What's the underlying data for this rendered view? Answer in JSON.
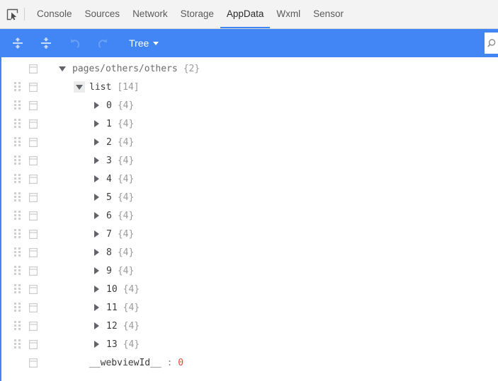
{
  "tabbar": {
    "inspect_icon": "inspect-element-icon",
    "tabs": [
      {
        "label": "Console",
        "active": false
      },
      {
        "label": "Sources",
        "active": false
      },
      {
        "label": "Network",
        "active": false
      },
      {
        "label": "Storage",
        "active": false
      },
      {
        "label": "AppData",
        "active": true
      },
      {
        "label": "Wxml",
        "active": false
      },
      {
        "label": "Sensor",
        "active": false
      }
    ]
  },
  "toolbar": {
    "expand_all_icon": "expand-all-icon",
    "collapse_all_icon": "collapse-all-icon",
    "undo_icon": "undo-icon",
    "redo_icon": "redo-icon",
    "view_mode_label": "Tree",
    "search_icon": "search-icon",
    "search_value": "",
    "search_placeholder": "",
    "accent_color": "#4285f4"
  },
  "tree": {
    "rows": [
      {
        "handle": false,
        "indent": 0,
        "toggle": "down",
        "toggle_highlight": false,
        "key": "pages/others/others",
        "key_style": "root",
        "meta": "{2}",
        "value": null
      },
      {
        "handle": true,
        "indent": 1,
        "toggle": "down",
        "toggle_highlight": true,
        "key": "list",
        "key_style": "key",
        "meta": "[14]",
        "value": null
      },
      {
        "handle": true,
        "indent": 2,
        "toggle": "right",
        "toggle_highlight": false,
        "key": "0",
        "key_style": "index",
        "meta": "{4}",
        "value": null
      },
      {
        "handle": true,
        "indent": 2,
        "toggle": "right",
        "toggle_highlight": false,
        "key": "1",
        "key_style": "index",
        "meta": "{4}",
        "value": null
      },
      {
        "handle": true,
        "indent": 2,
        "toggle": "right",
        "toggle_highlight": false,
        "key": "2",
        "key_style": "index",
        "meta": "{4}",
        "value": null
      },
      {
        "handle": true,
        "indent": 2,
        "toggle": "right",
        "toggle_highlight": false,
        "key": "3",
        "key_style": "index",
        "meta": "{4}",
        "value": null
      },
      {
        "handle": true,
        "indent": 2,
        "toggle": "right",
        "toggle_highlight": false,
        "key": "4",
        "key_style": "index",
        "meta": "{4}",
        "value": null
      },
      {
        "handle": true,
        "indent": 2,
        "toggle": "right",
        "toggle_highlight": false,
        "key": "5",
        "key_style": "index",
        "meta": "{4}",
        "value": null
      },
      {
        "handle": true,
        "indent": 2,
        "toggle": "right",
        "toggle_highlight": false,
        "key": "6",
        "key_style": "index",
        "meta": "{4}",
        "value": null
      },
      {
        "handle": true,
        "indent": 2,
        "toggle": "right",
        "toggle_highlight": false,
        "key": "7",
        "key_style": "index",
        "meta": "{4}",
        "value": null
      },
      {
        "handle": true,
        "indent": 2,
        "toggle": "right",
        "toggle_highlight": false,
        "key": "8",
        "key_style": "index",
        "meta": "{4}",
        "value": null
      },
      {
        "handle": true,
        "indent": 2,
        "toggle": "right",
        "toggle_highlight": false,
        "key": "9",
        "key_style": "index",
        "meta": "{4}",
        "value": null
      },
      {
        "handle": true,
        "indent": 2,
        "toggle": "right",
        "toggle_highlight": false,
        "key": "10",
        "key_style": "index",
        "meta": "{4}",
        "value": null
      },
      {
        "handle": true,
        "indent": 2,
        "toggle": "right",
        "toggle_highlight": false,
        "key": "11",
        "key_style": "index",
        "meta": "{4}",
        "value": null
      },
      {
        "handle": true,
        "indent": 2,
        "toggle": "right",
        "toggle_highlight": false,
        "key": "12",
        "key_style": "index",
        "meta": "{4}",
        "value": null
      },
      {
        "handle": true,
        "indent": 2,
        "toggle": "right",
        "toggle_highlight": false,
        "key": "13",
        "key_style": "index",
        "meta": "{4}",
        "value": null
      },
      {
        "handle": false,
        "indent": 1,
        "toggle": "none",
        "toggle_highlight": false,
        "key": "__webviewId__",
        "key_style": "key",
        "meta": null,
        "value": "0",
        "value_type": "number"
      }
    ]
  }
}
